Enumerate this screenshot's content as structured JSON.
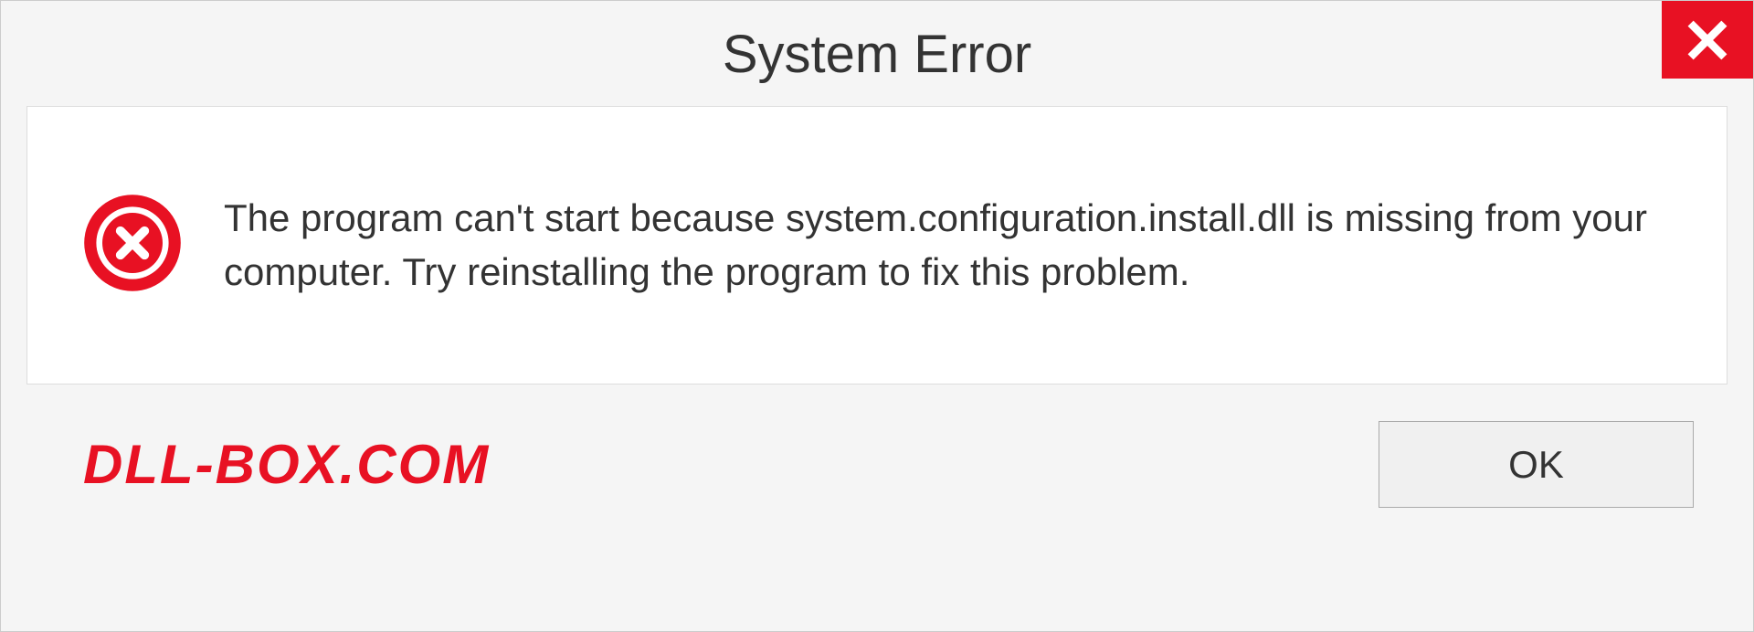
{
  "dialog": {
    "title": "System Error",
    "message": "The program can't start because system.configuration.install.dll is missing from your computer. Try reinstalling the program to fix this problem.",
    "ok_label": "OK"
  },
  "watermark": "DLL-BOX.COM"
}
